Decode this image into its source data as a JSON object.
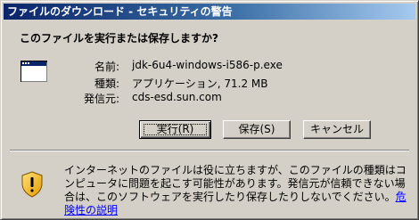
{
  "window": {
    "title": "ファイルのダウンロード - セキュリティの警告"
  },
  "question": "このファイルを実行または保存しますか?",
  "file": {
    "name_label": "名前:",
    "name_value": "jdk-6u4-windows-i586-p.exe",
    "type_label": "種類:",
    "type_value": "アプリケーション, 71.2 MB",
    "from_label": "発信元:",
    "from_value": "cds-esd.sun.com"
  },
  "buttons": {
    "run": "実行(R)",
    "save": "保存(S)",
    "cancel": "キャンセル"
  },
  "warning": {
    "text": "インターネットのファイルは役に立ちますが、このファイルの種類はコンピュータに問題を起こす可能性があります。発信元が信頼できない場合は、このソフトウェアを実行したり保存したりしないでください。",
    "link": "危険性の説明"
  },
  "icons": {
    "program": "program-window-icon",
    "shield": "security-warning-shield-icon"
  },
  "colors": {
    "title_start": "#0a246a",
    "title_end": "#a6caf0",
    "shield": "#f5b400",
    "link": "#0000ff"
  }
}
